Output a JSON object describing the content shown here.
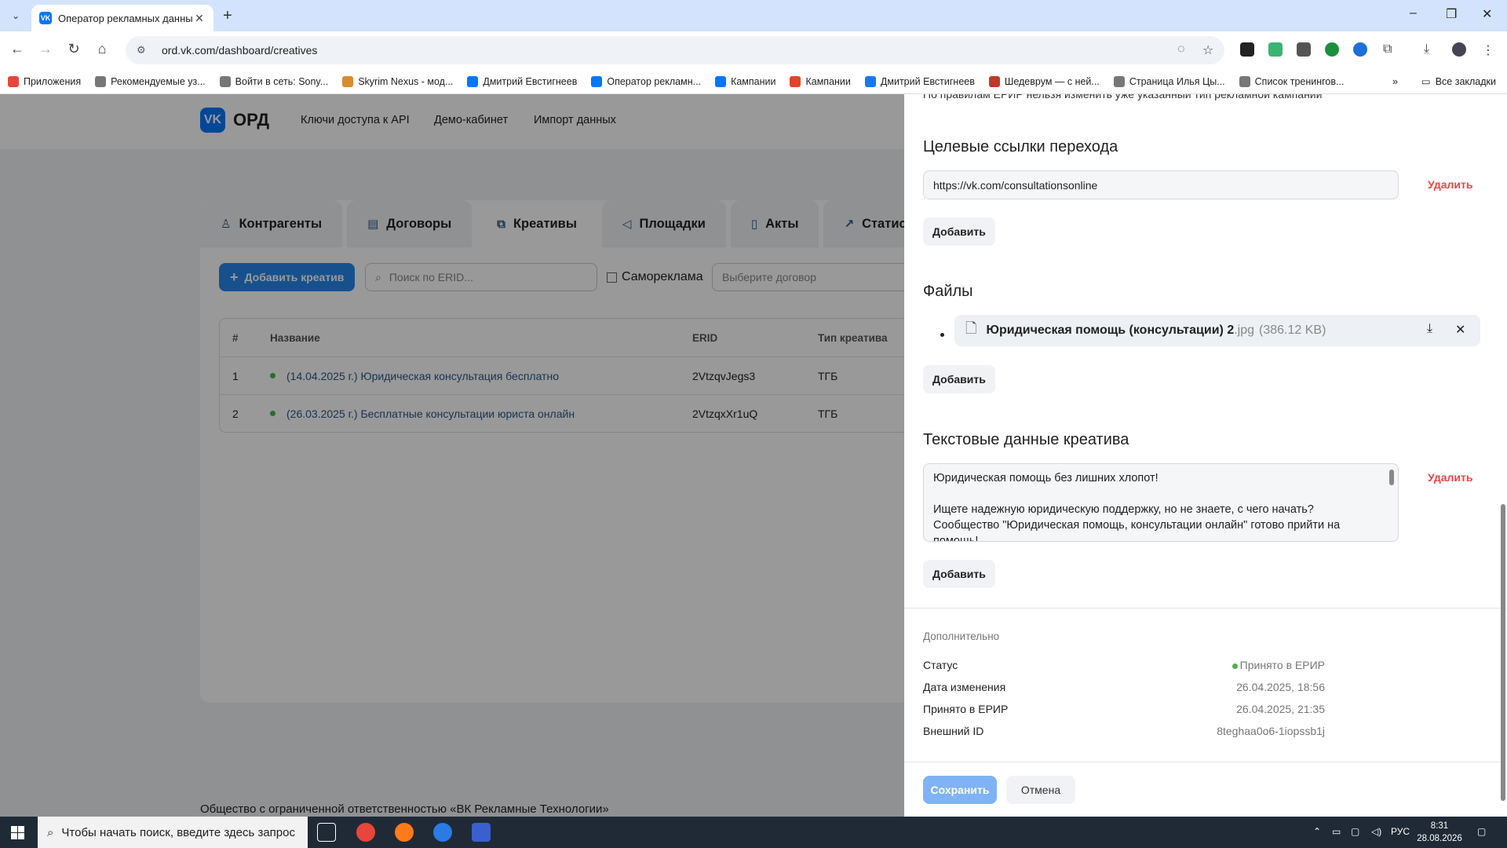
{
  "browser": {
    "tab_title": "Оператор рекламных данных",
    "tab_favicon": "VK",
    "url": "ord.vk.com/dashboard/creatives",
    "bookmarks": [
      {
        "label": "Приложения",
        "icon": "apps-grid-icon"
      },
      {
        "label": "Рекомендуемые уз...",
        "icon": "globe-icon"
      },
      {
        "label": "Войти в сеть: Sony...",
        "icon": "globe-icon"
      },
      {
        "label": "Skyrim Nexus - мод...",
        "icon": "nexus-icon"
      },
      {
        "label": "Дмитрий Евстигнеев",
        "icon": "vk-icon"
      },
      {
        "label": "Оператор рекламн...",
        "icon": "vk-icon"
      },
      {
        "label": "Кампании",
        "icon": "vk-ads-icon"
      },
      {
        "label": "Кампании",
        "icon": "mytarget-icon"
      },
      {
        "label": "Дмитрий Евстигнеев",
        "icon": "facebook-icon"
      },
      {
        "label": "Шедеврум — с ней...",
        "icon": "shedevrum-icon"
      },
      {
        "label": "Страница Илья Цы...",
        "icon": "globe-icon"
      },
      {
        "label": "Список тренингов...",
        "icon": "globe-icon"
      }
    ],
    "all_bookmarks": "Все закладки"
  },
  "site": {
    "logo": "ОРД",
    "logo_mark": "VK",
    "nav": [
      "Ключи доступа к API",
      "Демо-кабинет",
      "Импорт данных"
    ],
    "tabs": [
      "Контрагенты",
      "Договоры",
      "Креативы",
      "Площадки",
      "Акты",
      "Статистика"
    ],
    "add_button": "Добавить креатив",
    "search_placeholder": "Поиск по ERID...",
    "self_ad": "Самореклама",
    "contract_placeholder": "Выберите договор",
    "table": {
      "headers": [
        "#",
        "Название",
        "ERID",
        "Тип креатива"
      ],
      "rows": [
        {
          "num": "1",
          "name": "(14.04.2025 г.) Юридическая консультация бесплатно",
          "erid": "2VtzqvJegs3",
          "type": "ТГБ"
        },
        {
          "num": "2",
          "name": "(26.03.2025 г.) Бесплатные консультации юриста онлайн",
          "erid": "2VtzqxXr1uQ",
          "type": "ТГБ"
        }
      ]
    },
    "footer": "Общество с ограниченной ответственностью «ВК Рекламные Технологии»"
  },
  "drawer": {
    "top_note": "По правилам ЕРИР нельзя изменить уже указанный тип рекламной кампании",
    "links_title": "Целевые ссылки перехода",
    "link_value": "https://vk.com/consultationsonline",
    "delete_label": "Удалить",
    "add_label": "Добавить",
    "files_title": "Файлы",
    "file_name": "Юридическая помощь (консультации) 2",
    "file_ext": ".jpg",
    "file_size": "(386.12 KB)",
    "text_title": "Текстовые данные креатива",
    "text_value": "Юридическая помощь без лишних хлопот!\n\nИщете надежную юридическую поддержку, но не знаете, с чего начать? Сообщество \"Юридическая помощь, консультации онлайн\" готово прийти на помощь!",
    "extra_title": "Дополнительно",
    "details": [
      {
        "key": "Статус",
        "value": "Принято в ЕРИР"
      },
      {
        "key": "Дата изменения",
        "value": "26.04.2025, 18:56"
      },
      {
        "key": "Принято в ЕРИР",
        "value": "26.04.2025, 21:35"
      },
      {
        "key": "Внешний ID",
        "value": "8teghaa0o6-1iopssb1j"
      }
    ],
    "save_label": "Сохранить",
    "cancel_label": "Отмена"
  },
  "taskbar": {
    "search_placeholder": "Чтобы начать поиск, введите здесь запрос",
    "lang": "РУС",
    "time": "8:31",
    "date": "28.08.2026"
  },
  "colors": {
    "accent": "#2688eb",
    "link": "#2a5885",
    "danger": "#e64646",
    "success": "#4bb34b"
  }
}
